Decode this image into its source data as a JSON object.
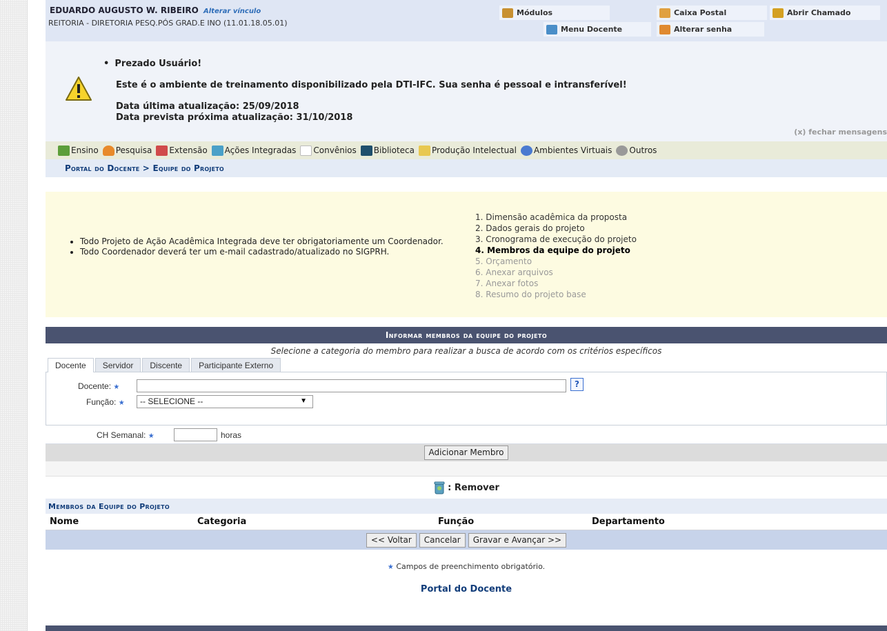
{
  "header": {
    "user_name": "EDUARDO AUGUSTO W. RIBEIRO",
    "change_link": "Alterar vínculo",
    "unit": "REITORIA - DIRETORIA PESQ.PÓS GRAD.E INO (11.01.18.05.01)",
    "buttons": {
      "modulos": "Módulos",
      "caixa_postal": "Caixa Postal",
      "abrir_chamado": "Abrir Chamado",
      "menu_docente": "Menu Docente",
      "alterar_senha": "Alterar senha"
    }
  },
  "message": {
    "title": "Prezado Usuário!",
    "line1": "Este é o ambiente de treinamento disponibilizado pela DTI-IFC. Sua senha é pessoal e intransferível!",
    "line2": "Data última atualização: 25/09/2018",
    "line3": "Data prevista próxima atualização: 31/10/2018",
    "close": "(x) fechar mensagens"
  },
  "menu": [
    "Ensino",
    "Pesquisa",
    "Extensão",
    "Ações Integradas",
    "Convênios",
    "Biblioteca",
    "Produção Intelectual",
    "Ambientes Virtuais",
    "Outros"
  ],
  "breadcrumb": "Portal do Docente > Equipe do Projeto",
  "info": {
    "notes": [
      "Todo Projeto de Ação Acadêmica Integrada deve ter obrigatoriamente um Coordenador.",
      "Todo Coordenador deverá ter um e-mail cadastrado/atualizado no SIGPRH."
    ],
    "steps": [
      "1. Dimensão acadêmica da proposta",
      "2. Dados gerais do projeto",
      "3. Cronograma de execução do projeto",
      "4. Membros da equipe do projeto",
      "5. Orçamento",
      "6. Anexar arquivos",
      "7. Anexar fotos",
      "8. Resumo do projeto base"
    ]
  },
  "form": {
    "title": "Informar membros da equipe do projeto",
    "subtitle": "Selecione a categoria do membro para realizar a busca de acordo com os critérios específicos",
    "tabs": [
      "Docente",
      "Servidor",
      "Discente",
      "Participante Externo"
    ],
    "docente_label": "Docente:",
    "funcao_label": "Função:",
    "funcao_selected": "-- SELECIONE --",
    "help": "?",
    "ch_label": "CH Semanal:",
    "ch_unit": "horas",
    "add_button": "Adicionar Membro",
    "remove_label": ": Remover"
  },
  "members": {
    "title": "Membros da Equipe do Projeto",
    "columns": [
      "Nome",
      "Categoria",
      "Função",
      "Departamento"
    ]
  },
  "actions": {
    "back": "<< Voltar",
    "cancel": "Cancelar",
    "save": "Gravar e Avançar >>"
  },
  "required_note": "Campos de preenchimento obrigatório.",
  "footer_link": "Portal do Docente",
  "icons": [
    "box-icon",
    "mailbox-icon",
    "ticket-icon",
    "menu-icon",
    "key-icon",
    "warning-icon",
    "books-icon",
    "flask-icon",
    "heart-icon",
    "puzzle-icon",
    "document-icon",
    "library-icon",
    "notebook-icon",
    "globe-icon",
    "gears-icon",
    "trash-icon"
  ]
}
